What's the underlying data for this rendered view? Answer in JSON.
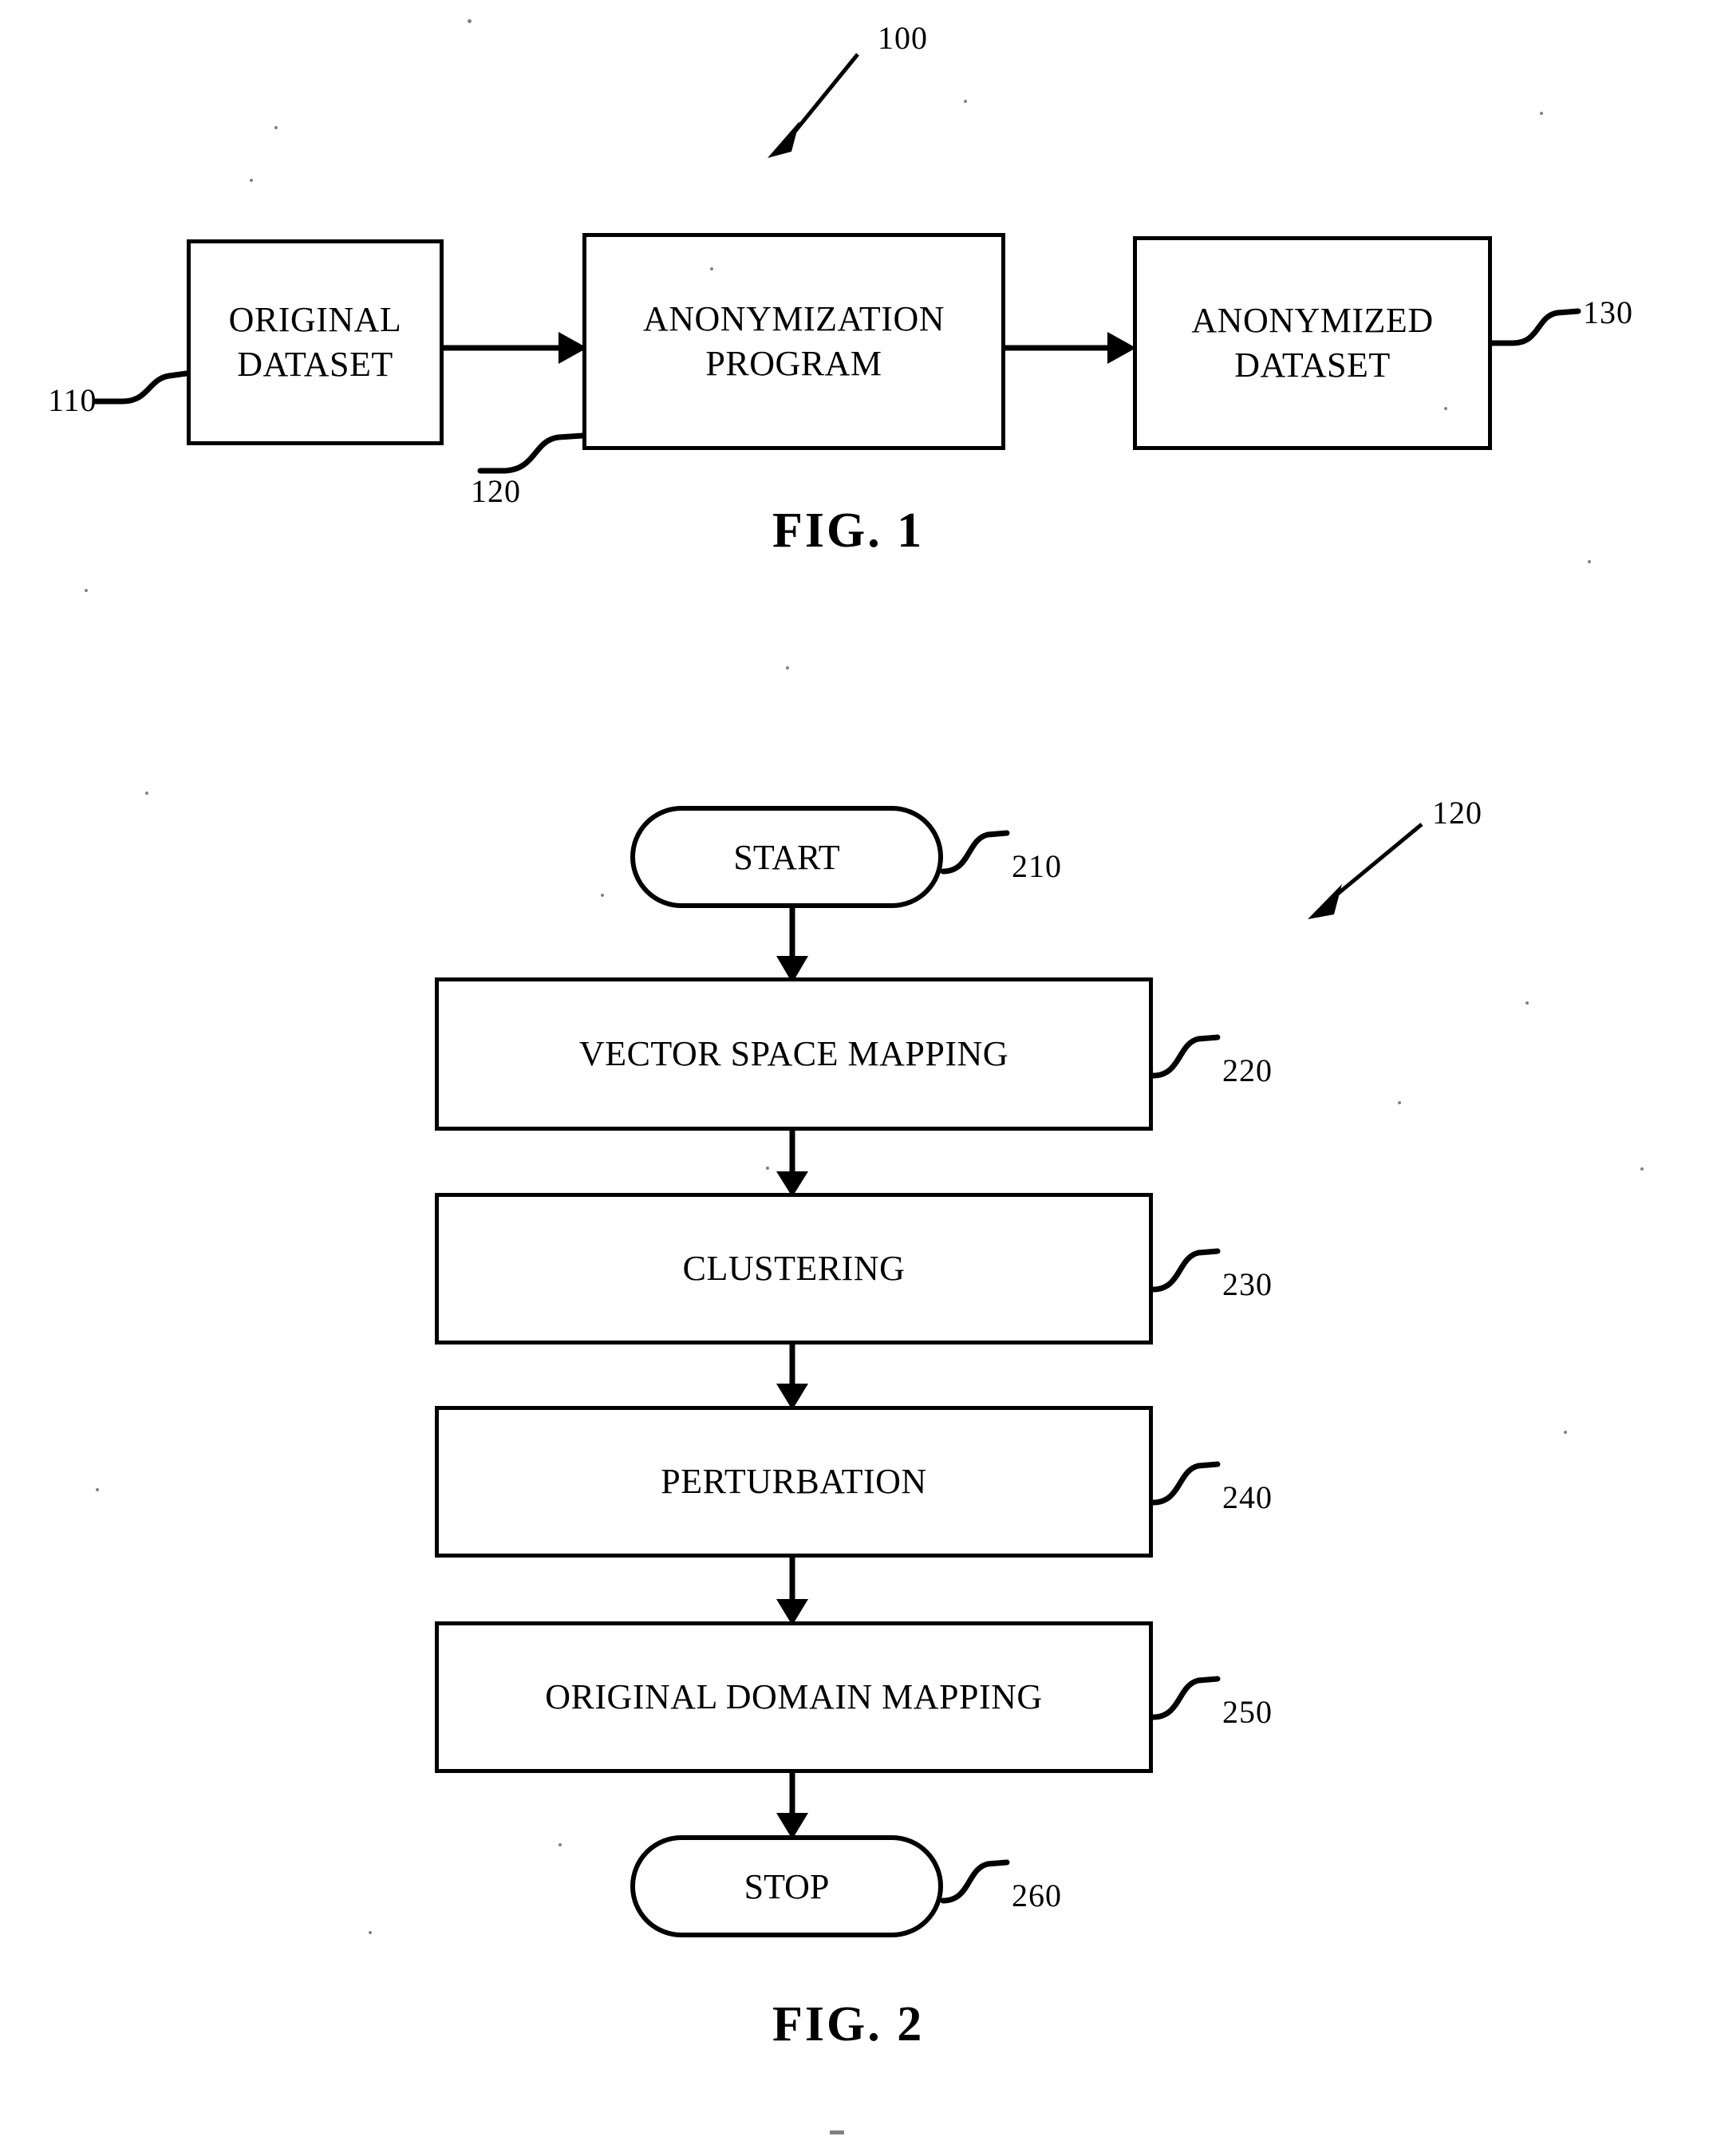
{
  "document": {
    "type": "patent-drawing-sheet",
    "background_color": "#ffffff",
    "ink_color": "#000000"
  },
  "figure1": {
    "caption": "FIG. 1",
    "system_ref": "100",
    "blocks": [
      {
        "id": "original-dataset",
        "label": "ORIGINAL\nDATASET",
        "line1": "ORIGINAL",
        "line2": "DATASET",
        "ref": "110"
      },
      {
        "id": "anonymization-program",
        "label": "ANONYMIZATION\nPROGRAM",
        "line1": "ANONYMIZATION",
        "line2": "PROGRAM",
        "ref": "120"
      },
      {
        "id": "anonymized-dataset",
        "label": "ANONYMIZED\nDATASET",
        "line1": "ANONYMIZED",
        "line2": "DATASET",
        "ref": "130"
      }
    ],
    "connectors": [
      {
        "from": "original-dataset",
        "to": "anonymization-program",
        "direction": "right"
      },
      {
        "from": "anonymization-program",
        "to": "anonymized-dataset",
        "direction": "right"
      }
    ]
  },
  "figure2": {
    "caption": "FIG. 2",
    "process_ref": "120",
    "steps": [
      {
        "id": "start",
        "shape": "terminator",
        "label": "START",
        "ref": "210"
      },
      {
        "id": "vector-space-mapping",
        "shape": "process",
        "label": "VECTOR SPACE MAPPING",
        "ref": "220"
      },
      {
        "id": "clustering",
        "shape": "process",
        "label": "CLUSTERING",
        "ref": "230"
      },
      {
        "id": "perturbation",
        "shape": "process",
        "label": "PERTURBATION",
        "ref": "240"
      },
      {
        "id": "original-domain-mapping",
        "shape": "process",
        "label": "ORIGINAL DOMAIN MAPPING",
        "ref": "250"
      },
      {
        "id": "stop",
        "shape": "terminator",
        "label": "STOP",
        "ref": "260"
      }
    ],
    "connectors": [
      {
        "from": "start",
        "to": "vector-space-mapping",
        "direction": "down"
      },
      {
        "from": "vector-space-mapping",
        "to": "clustering",
        "direction": "down"
      },
      {
        "from": "clustering",
        "to": "perturbation",
        "direction": "down"
      },
      {
        "from": "perturbation",
        "to": "original-domain-mapping",
        "direction": "down"
      },
      {
        "from": "original-domain-mapping",
        "to": "stop",
        "direction": "down"
      }
    ]
  }
}
